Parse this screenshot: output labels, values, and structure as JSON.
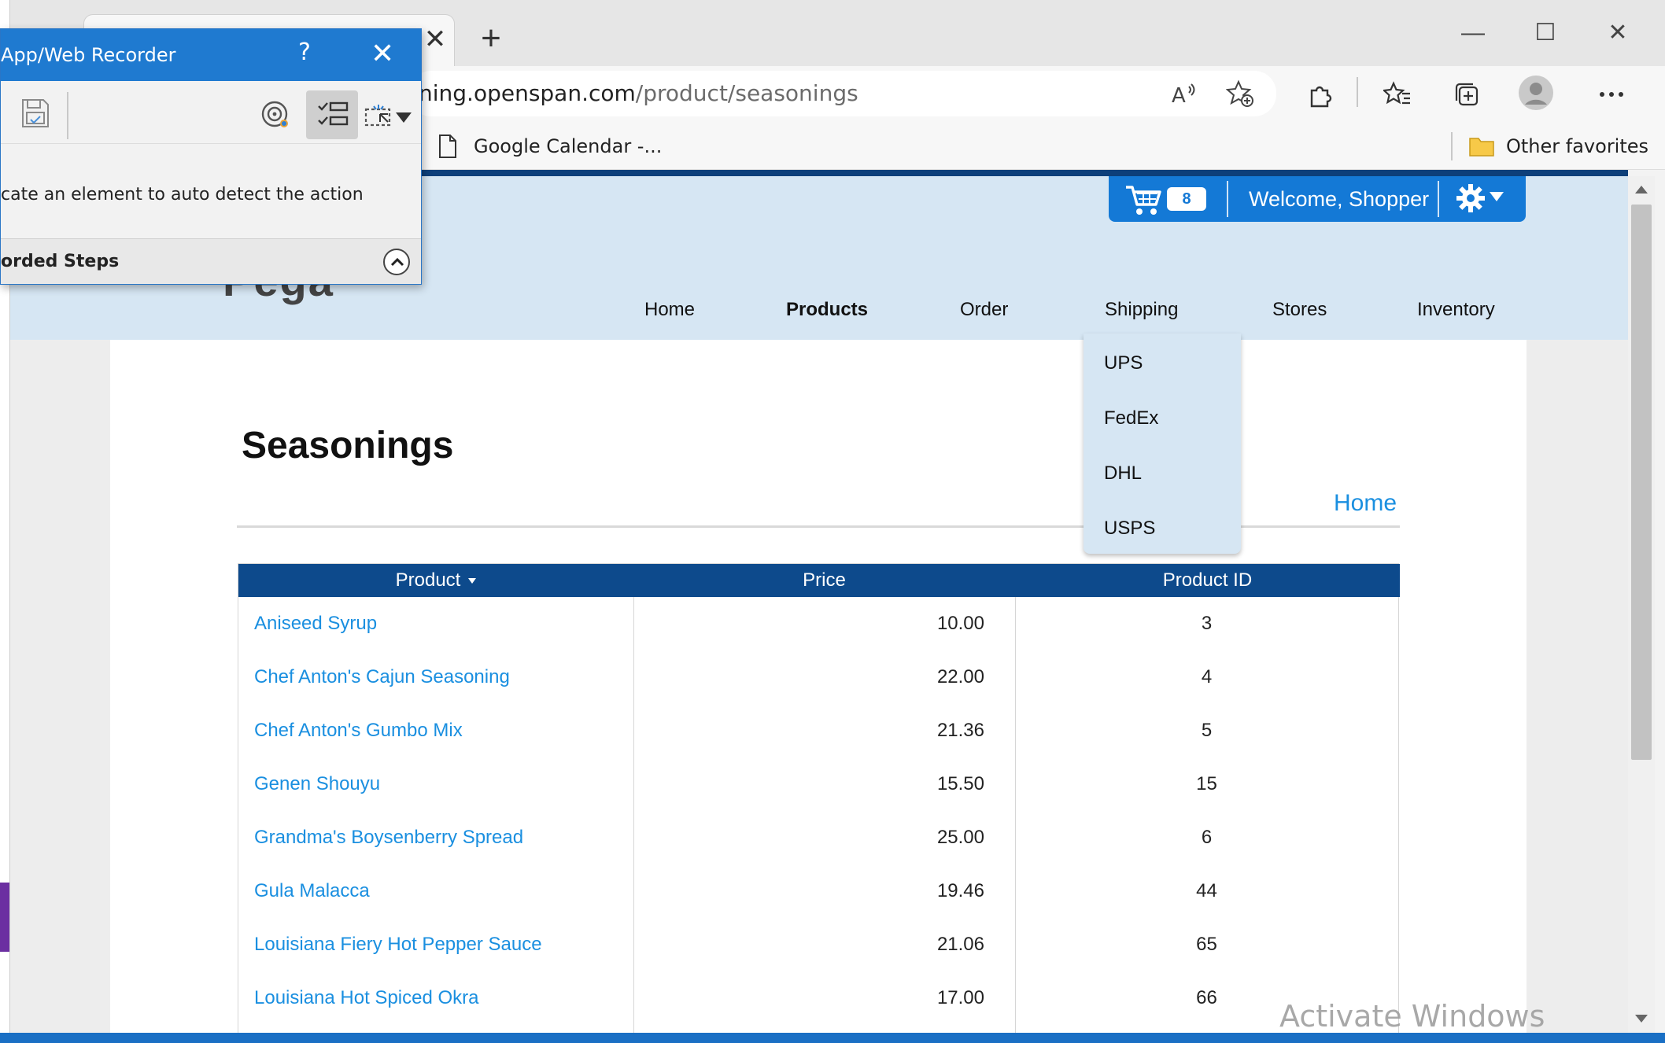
{
  "browser": {
    "tab_close_glyph": "✕",
    "new_tab_glyph": "+",
    "address": {
      "host": "ning.openspan.com",
      "path": "/product/seasonings"
    },
    "favorites": [
      {
        "label": "Google Calendar -..."
      }
    ],
    "other_favorites": "Other favorites",
    "profile_icon": "profile-avatar",
    "window_controls": {
      "minimize": "—",
      "maximize": "☐",
      "close": "✕"
    }
  },
  "recorder": {
    "title": "App/Web Recorder",
    "help": "?",
    "close": "✕",
    "hint": "cate an element to auto detect the action",
    "steps_label": "orded Steps"
  },
  "site": {
    "logo": "Pega",
    "cart_count": "8",
    "welcome": "Welcome, Shopper",
    "nav": [
      "Home",
      "Products",
      "Order",
      "Shipping",
      "Stores",
      "Inventory"
    ],
    "active_nav": "Products",
    "shipping_menu": [
      "UPS",
      "FedEx",
      "DHL",
      "USPS"
    ]
  },
  "page": {
    "title": "Seasonings",
    "home_link": "Home"
  },
  "table": {
    "columns": [
      "Product",
      "Price",
      "Product ID"
    ],
    "rows": [
      {
        "product": "Aniseed Syrup",
        "price": "10.00",
        "id": "3"
      },
      {
        "product": "Chef Anton's Cajun Seasoning",
        "price": "22.00",
        "id": "4"
      },
      {
        "product": "Chef Anton's Gumbo Mix",
        "price": "21.36",
        "id": "5"
      },
      {
        "product": "Genen Shouyu",
        "price": "15.50",
        "id": "15"
      },
      {
        "product": "Grandma's Boysenberry Spread",
        "price": "25.00",
        "id": "6"
      },
      {
        "product": "Gula Malacca",
        "price": "19.46",
        "id": "44"
      },
      {
        "product": "Louisiana Fiery Hot Pepper Sauce",
        "price": "21.06",
        "id": "65"
      },
      {
        "product": "Louisiana Hot Spiced Okra",
        "price": "17.00",
        "id": "66"
      }
    ]
  },
  "watermark": "Activate Windows",
  "colors": {
    "brand_blue": "#1479d6",
    "header_bg": "#d6e6f3",
    "table_head": "#0d4a8c",
    "link": "#1a8fe0"
  }
}
